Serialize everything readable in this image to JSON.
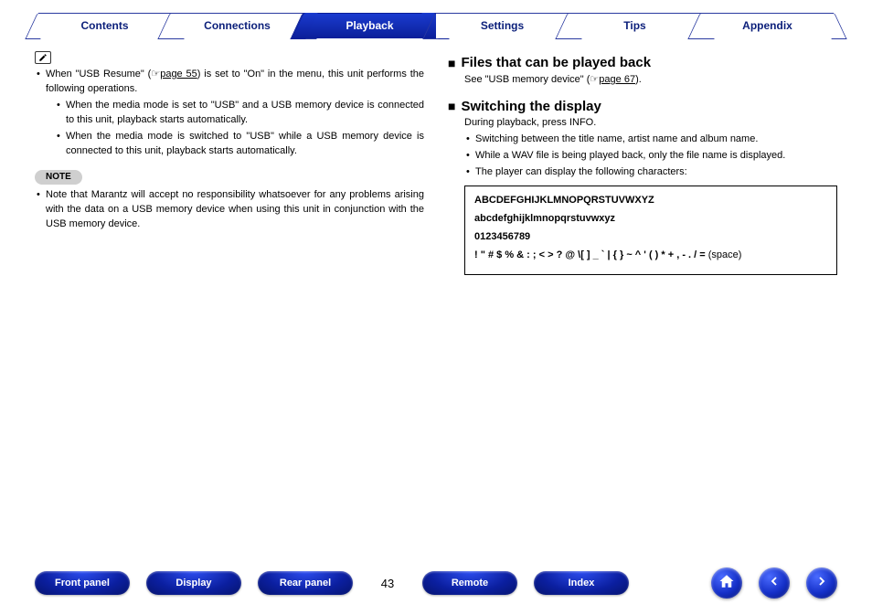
{
  "tabs": {
    "items": [
      {
        "label": "Contents",
        "active": false
      },
      {
        "label": "Connections",
        "active": false
      },
      {
        "label": "Playback",
        "active": true
      },
      {
        "label": "Settings",
        "active": false
      },
      {
        "label": "Tips",
        "active": false
      },
      {
        "label": "Appendix",
        "active": false
      }
    ]
  },
  "left": {
    "bullet1_pre": "When \"USB Resume\" (",
    "bullet1_icon": "☞",
    "bullet1_link": "page 55",
    "bullet1_post": ") is set to \"On\" in the menu, this unit performs the following operations.",
    "sub1": "When the media mode is set to \"USB\" and a USB memory device is connected to this unit, playback starts automatically.",
    "sub2": "When the media mode is switched to \"USB\" while a USB memory device is connected to this unit, playback starts automatically.",
    "note_label": "NOTE",
    "note_text": "Note that Marantz will accept no responsibility whatsoever for any problems arising with the data on a USB memory device when using this unit in conjunction with the USB memory device."
  },
  "right": {
    "h1": "Files that can be played back",
    "h1_sub_pre": "See \"USB memory device\" (",
    "h1_sub_icon": "☞",
    "h1_sub_link": "page 67",
    "h1_sub_post": ").",
    "h2": "Switching the display",
    "h2_line1": "During playback, press INFO.",
    "h2_b1": "Switching between the title name, artist name and album name.",
    "h2_b2": "While a WAV file is being played back, only the file name is displayed.",
    "h2_b3": "The player can display the following characters:",
    "chars": {
      "upper": "ABCDEFGHIJKLMNOPQRSTUVWXYZ",
      "lower": "abcdefghijklmnopqrstuvwxyz",
      "digits": "0123456789",
      "symbols": "! \" # $ % & : ; < > ? @ \\[ ] _ ` | { } ~ ^ ' ( ) * + , - . / =",
      "space": " (space)"
    }
  },
  "bottom": {
    "front": "Front panel",
    "display": "Display",
    "rear": "Rear panel",
    "page": "43",
    "remote": "Remote",
    "index": "Index"
  }
}
